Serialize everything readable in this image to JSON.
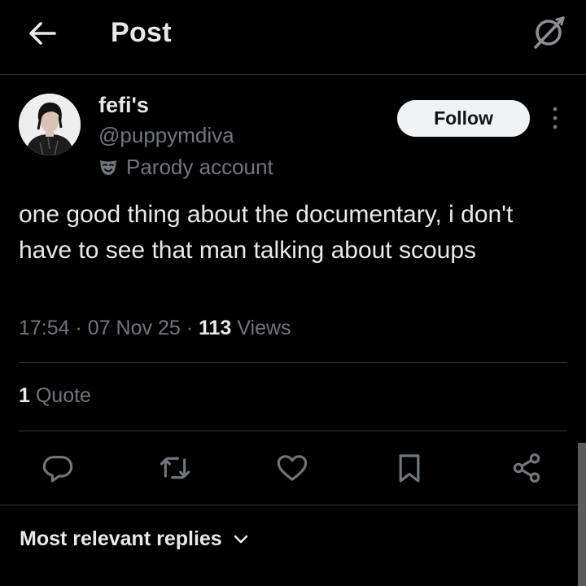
{
  "header": {
    "back_icon": "arrow-left-icon",
    "title": "Post",
    "grok_icon": "grok-icon"
  },
  "author": {
    "display_name": "fefi's",
    "username": "@puppymdiva",
    "badge_icon": "theater-mask-icon",
    "badge_label": "Parody account",
    "follow_label": "Follow",
    "more_icon": "more-vertical-icon"
  },
  "post": {
    "text": "one good thing about the documentary, i don't have to see that man talking about scoups",
    "time": "17:54",
    "date": "07 Nov 25",
    "views_count": "113",
    "views_label": "Views",
    "quote_count": "1",
    "quote_label": "Quote"
  },
  "actions": {
    "reply_icon": "reply-icon",
    "repost_icon": "repost-icon",
    "like_icon": "heart-icon",
    "bookmark_icon": "bookmark-icon",
    "share_icon": "share-icon"
  },
  "replies": {
    "sort_label": "Most relevant replies",
    "sort_icon": "chevron-down-icon"
  },
  "colors": {
    "background": "#000000",
    "text_primary": "#e7e9ea",
    "text_secondary": "#71767b",
    "divider": "#2f3336",
    "follow_bg": "#eff3f4"
  }
}
